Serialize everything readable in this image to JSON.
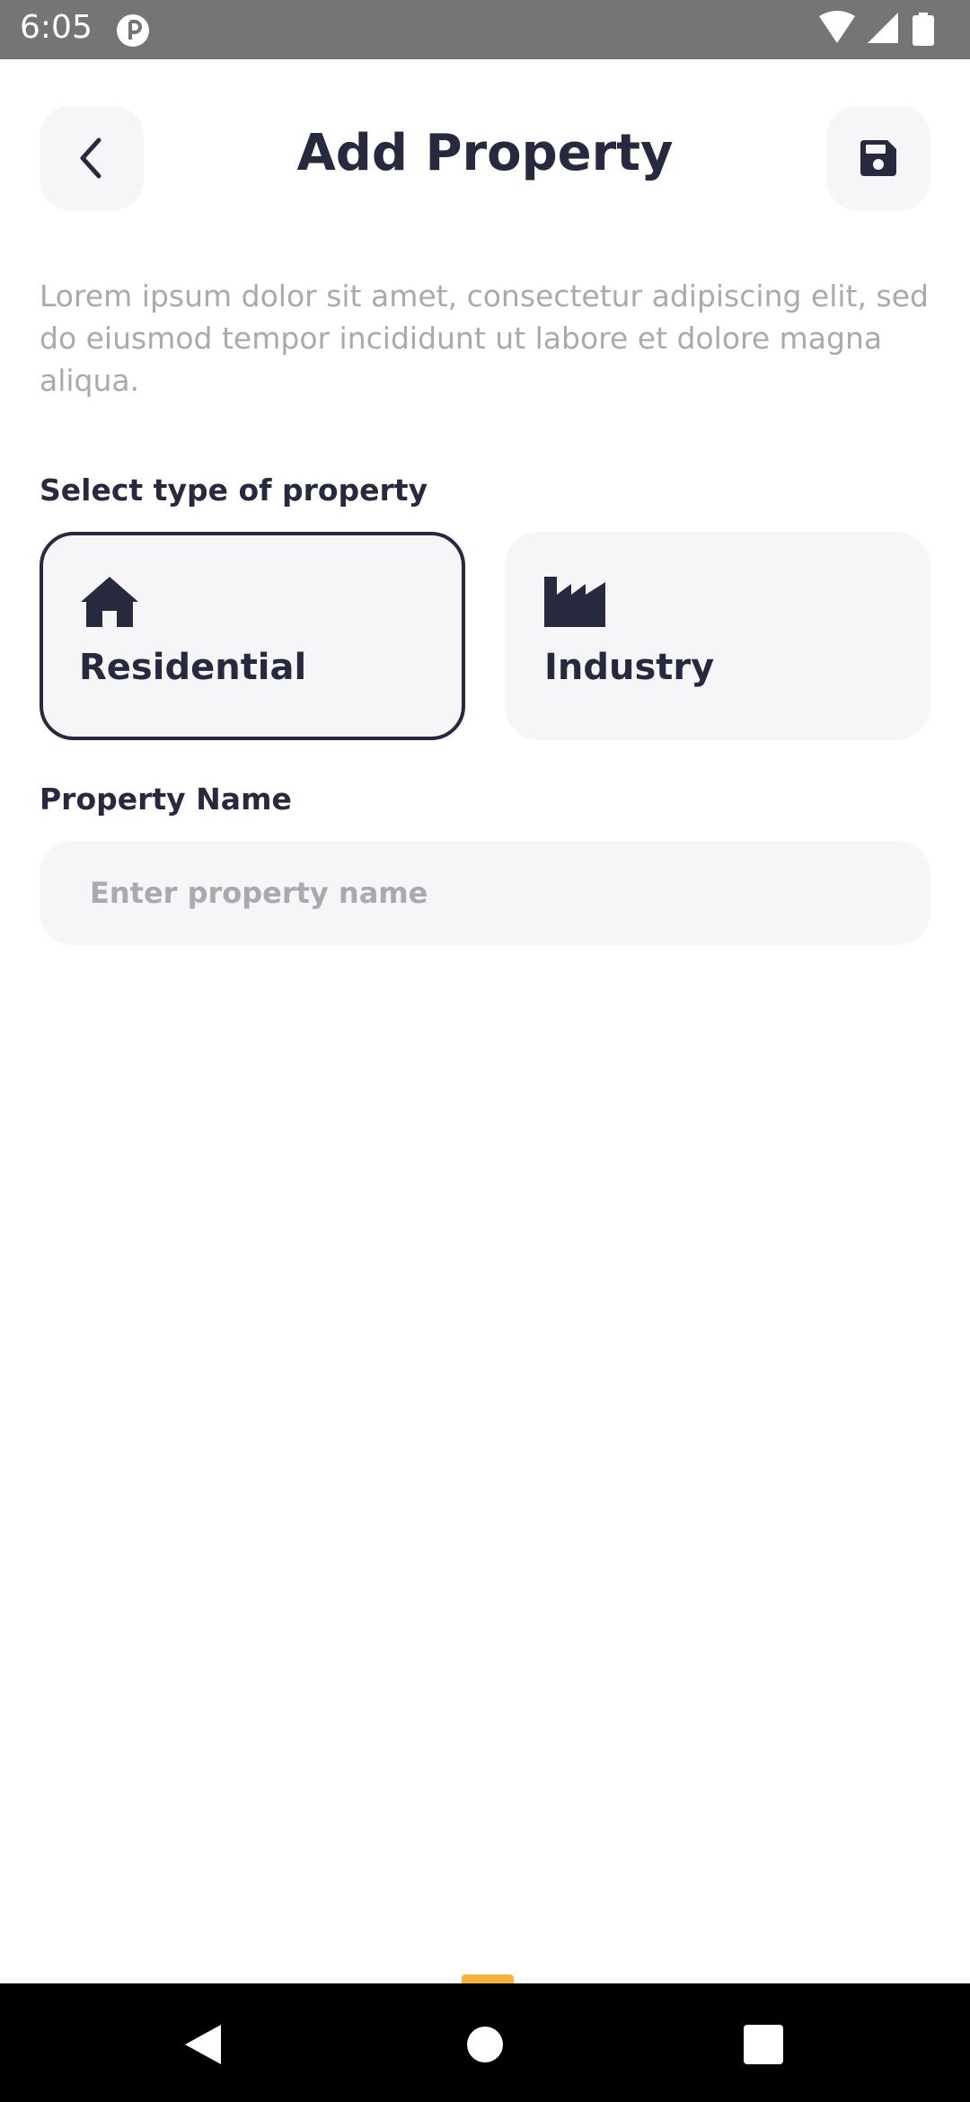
{
  "status_bar": {
    "time": "6:05"
  },
  "header": {
    "title": "Add Property"
  },
  "description": "Lorem ipsum dolor sit amet, consectetur adipiscing elit, sed do eiusmod tempor incididunt ut labore et dolore magna aliqua.",
  "property_type": {
    "label": "Select type of property",
    "options": [
      {
        "label": "Residential",
        "icon": "home-icon",
        "selected": true
      },
      {
        "label": "Industry",
        "icon": "factory-icon",
        "selected": false
      }
    ]
  },
  "property_name": {
    "label": "Property Name",
    "value": "",
    "placeholder": "Enter property name"
  },
  "colors": {
    "primary": "#272a3f",
    "surface": "#f6f6f8",
    "muted_text": "#a9a9b0",
    "status_bar": "#757575",
    "accent": "#f5b040"
  }
}
